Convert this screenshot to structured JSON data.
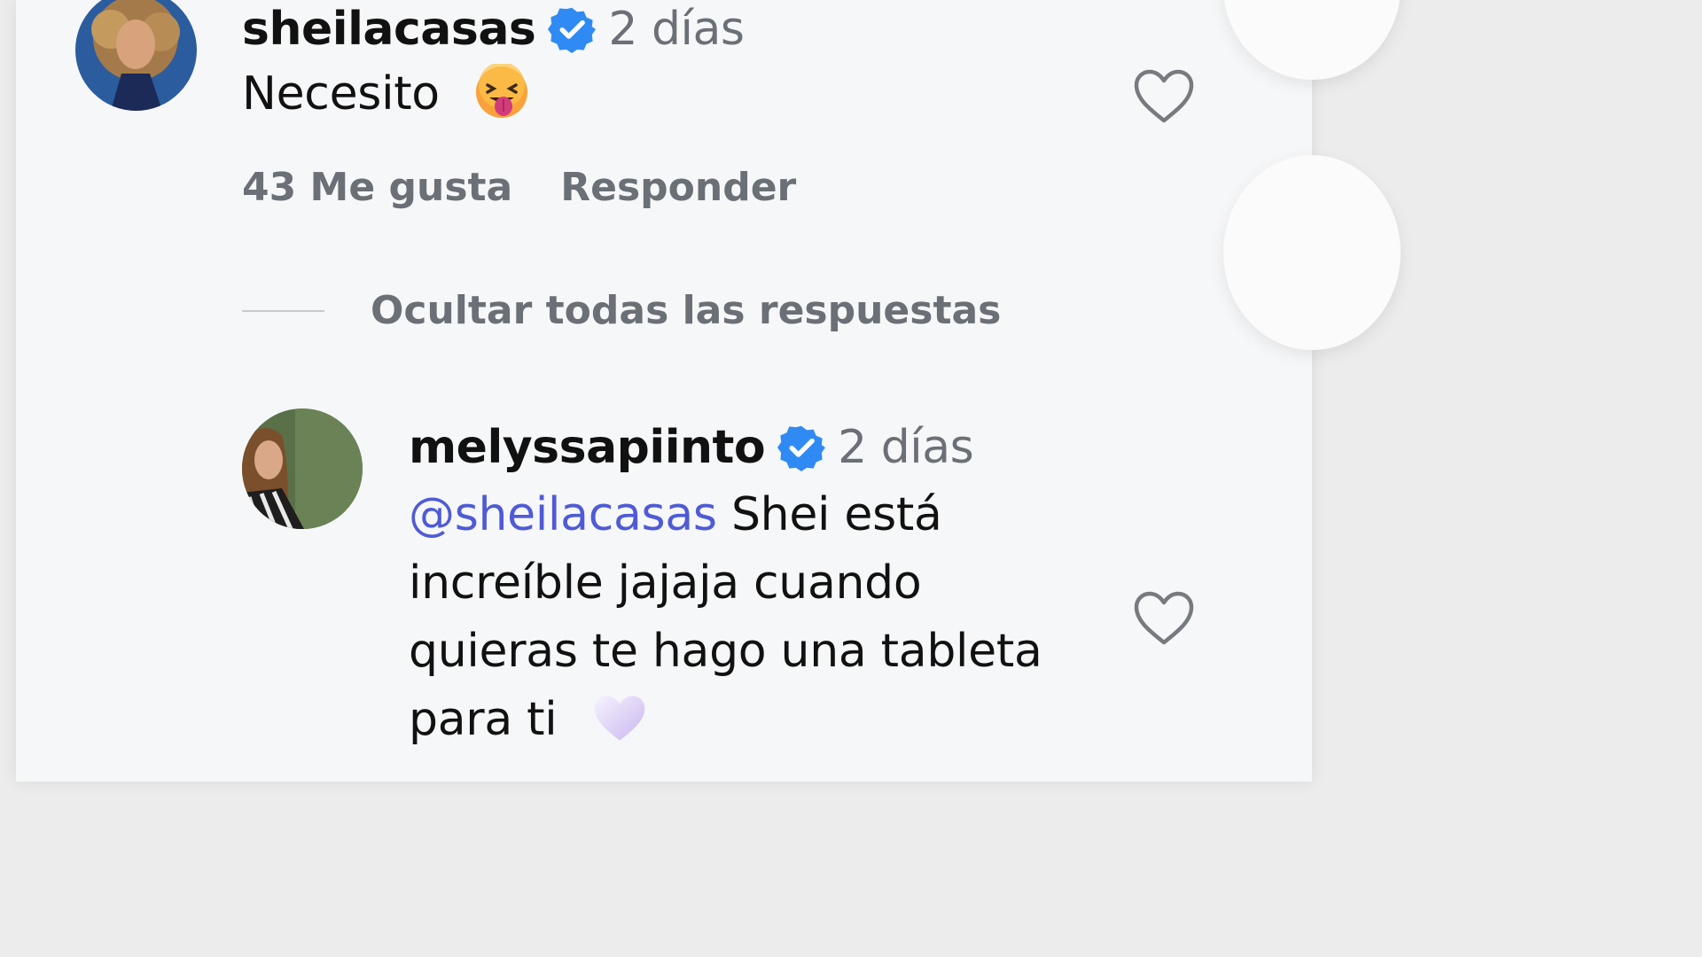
{
  "comments": [
    {
      "username": "sheilacasas",
      "verified": true,
      "timestamp": "2 días",
      "text": "Necesito",
      "emoji": "face-with-tongue-emoji",
      "likes_label": "43 Me gusta",
      "reply_label": "Responder"
    }
  ],
  "replies_toggle": {
    "label": "Ocultar todas las respuestas"
  },
  "replies": [
    {
      "username": "melyssapiinto",
      "verified": true,
      "timestamp": "2 días",
      "mention": "@sheilacasas",
      "text_line1": " Shei está",
      "text_line2": "increíble jajaja cuando",
      "text_line3": "quieras te hago una tableta",
      "text_line4": "para ti",
      "emoji": "white-heart-emoji"
    }
  ],
  "colors": {
    "text": "#111111",
    "secondary": "#6b6f76",
    "mention": "#4f5bd5",
    "verified": "#2f8bf3",
    "background": "#f6f7f8"
  }
}
